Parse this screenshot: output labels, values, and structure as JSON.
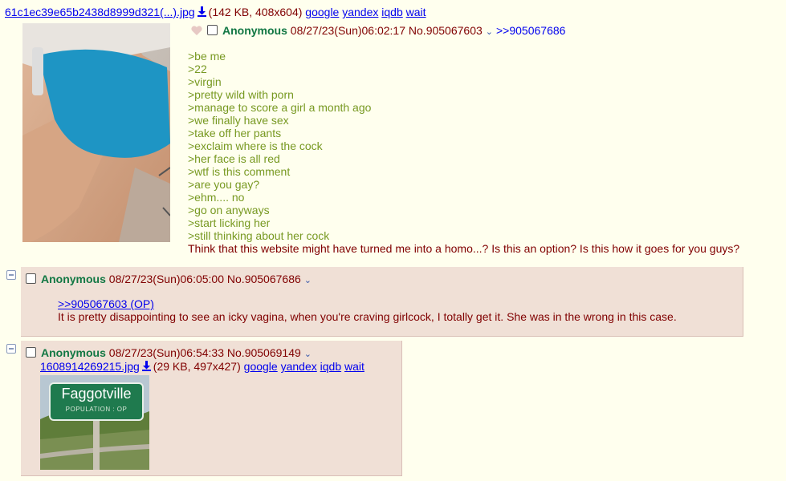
{
  "op": {
    "file_name": "61c1ec39e65b2438d8999d321(...).jpg",
    "file_info": "(142 KB, 408x604)",
    "search_links": [
      "google",
      "yandex",
      "iqdb",
      "wait"
    ],
    "name": "Anonymous",
    "datetime": "08/27/23(Sun)06:02:17",
    "post_no": "No.905067603",
    "backlink": ">>905067686",
    "greentext": [
      ">be me",
      ">22",
      ">virgin",
      ">pretty wild with porn",
      ">manage to score a girl a month ago",
      ">we finally have sex",
      ">take off her pants",
      ">exclaim where is the cock",
      ">her face is all red",
      ">wtf is this comment",
      ">are you gay?",
      ">ehm.... no",
      ">go on anyways",
      ">start licking her",
      ">still thinking about her cock"
    ],
    "closing_line": "Think that this website might have turned me into a homo...? Is this an option? Is this how it goes for you guys?"
  },
  "reply1": {
    "name": "Anonymous",
    "datetime": "08/27/23(Sun)06:05:00",
    "post_no": "No.905067686",
    "quote": ">>905067603 (OP)",
    "text": "It is pretty disappointing to see an icky vagina, when you're craving girlcock, I totally get it. She was in the wrong in this case."
  },
  "reply2": {
    "name": "Anonymous",
    "datetime": "08/27/23(Sun)06:54:33",
    "post_no": "No.905069149",
    "file_name": "1608914269215.jpg",
    "file_info": "(29 KB, 497x427)",
    "search_links": [
      "google",
      "yandex",
      "iqdb",
      "wait"
    ],
    "sign_title": "Faggotville",
    "sign_subtitle": "POPULATION : OP"
  },
  "colors": {
    "background": "#ffffee",
    "reply_bg": "#f0e0d6",
    "name": "#117743",
    "greentext": "#789922",
    "text": "#800000",
    "link": "#0000ee"
  }
}
